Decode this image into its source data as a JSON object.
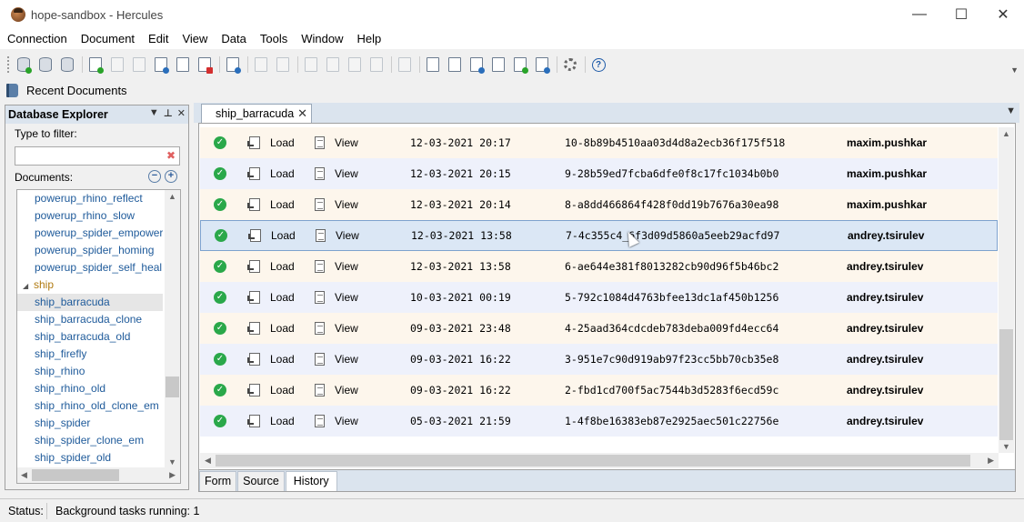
{
  "window": {
    "title": "hope-sandbox - Hercules",
    "minimize": "—",
    "maximize": "☐",
    "close": "✕"
  },
  "menu": [
    "Connection",
    "Document",
    "Edit",
    "View",
    "Data",
    "Tools",
    "Window",
    "Help"
  ],
  "recent_documents": {
    "label": "Recent Documents"
  },
  "explorer": {
    "title": "Database Explorer",
    "filter_label": "Type to filter:",
    "filter_value": "",
    "documents_label": "Documents:",
    "tree": [
      {
        "label": "powerup_rhino_reflect"
      },
      {
        "label": "powerup_rhino_slow"
      },
      {
        "label": "powerup_spider_empower"
      },
      {
        "label": "powerup_spider_homing"
      },
      {
        "label": "powerup_spider_self_heal"
      },
      {
        "label": "ship"
      },
      {
        "label": "ship_barracuda"
      },
      {
        "label": "ship_barracuda_clone"
      },
      {
        "label": "ship_barracuda_old"
      },
      {
        "label": "ship_firefly"
      },
      {
        "label": "ship_rhino"
      },
      {
        "label": "ship_rhino_old"
      },
      {
        "label": "ship_rhino_old_clone_em"
      },
      {
        "label": "ship_spider"
      },
      {
        "label": "ship_spider_clone_em"
      },
      {
        "label": "ship_spider_old"
      }
    ]
  },
  "document_tab": {
    "label": "ship_barracuda"
  },
  "history": {
    "load_label": "Load",
    "view_label": "View",
    "rows": [
      {
        "date": "12-03-2021 20:17",
        "hash": "10-8b89b4510aa03d4d8a2ecb36f175f518",
        "user": "maxim.pushkar"
      },
      {
        "date": "12-03-2021 20:15",
        "hash": "9-28b59ed7fcba6dfe0f8c17fc1034b0b0",
        "user": "maxim.pushkar"
      },
      {
        "date": "12-03-2021 20:14",
        "hash": "8-a8dd466864f428f0dd19b7676a30ea98",
        "user": "maxim.pushkar"
      },
      {
        "date": "12-03-2021 13:58",
        "hash": "7-4c355c4_6f3d09d5860a5eeb29acfd97",
        "user": "andrey.tsirulev"
      },
      {
        "date": "12-03-2021 13:58",
        "hash": "6-ae644e381f8013282cb90d96f5b46bc2",
        "user": "andrey.tsirulev"
      },
      {
        "date": "10-03-2021 00:19",
        "hash": "5-792c1084d4763bfee13dc1af450b1256",
        "user": "andrey.tsirulev"
      },
      {
        "date": "09-03-2021 23:48",
        "hash": "4-25aad364cdcdeb783deba009fd4ecc64",
        "user": "andrey.tsirulev"
      },
      {
        "date": "09-03-2021 16:22",
        "hash": "3-951e7c90d919ab97f23cc5bb70cb35e8",
        "user": "andrey.tsirulev"
      },
      {
        "date": "09-03-2021 16:22",
        "hash": "2-fbd1cd700f5ac7544b3d5283f6ecd59c",
        "user": "andrey.tsirulev"
      },
      {
        "date": "05-03-2021 21:59",
        "hash": "1-4f8be16383eb87e2925aec501c22756e",
        "user": "andrey.tsirulev"
      }
    ]
  },
  "bottom_tabs": [
    "Form",
    "Source",
    "History"
  ],
  "status": {
    "label": "Status:",
    "text": "Background tasks running: 1"
  }
}
